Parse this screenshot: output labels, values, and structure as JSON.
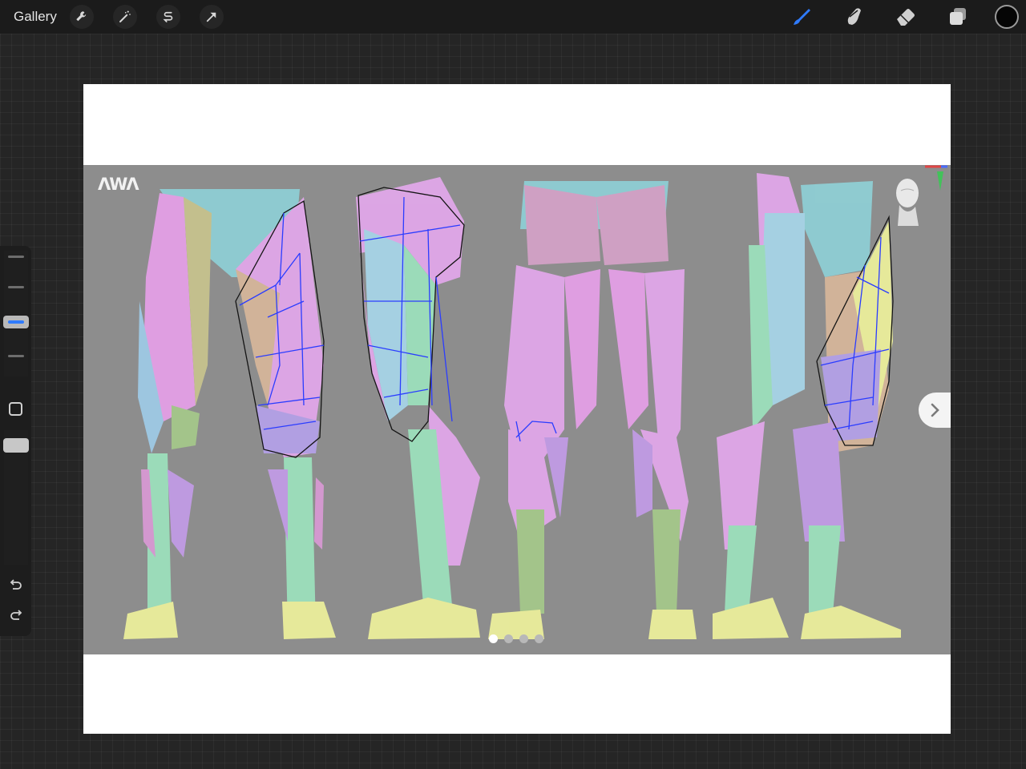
{
  "topbar": {
    "gallery_label": "Gallery",
    "left_tools": [
      "wrench-icon",
      "magic-wand-icon",
      "selection-s-icon",
      "transform-arrow-icon"
    ],
    "right_tools": [
      "brush-icon",
      "smudge-icon",
      "eraser-icon",
      "layers-icon"
    ],
    "current_color": "#050505",
    "accent_color": "#2f7bff"
  },
  "sidebar": {
    "brush_size_level": 0.78,
    "opacity_level": 0.7
  },
  "reference": {
    "logo_text": "ΛWΛ",
    "carousel_total": 4,
    "carousel_active": 1
  }
}
